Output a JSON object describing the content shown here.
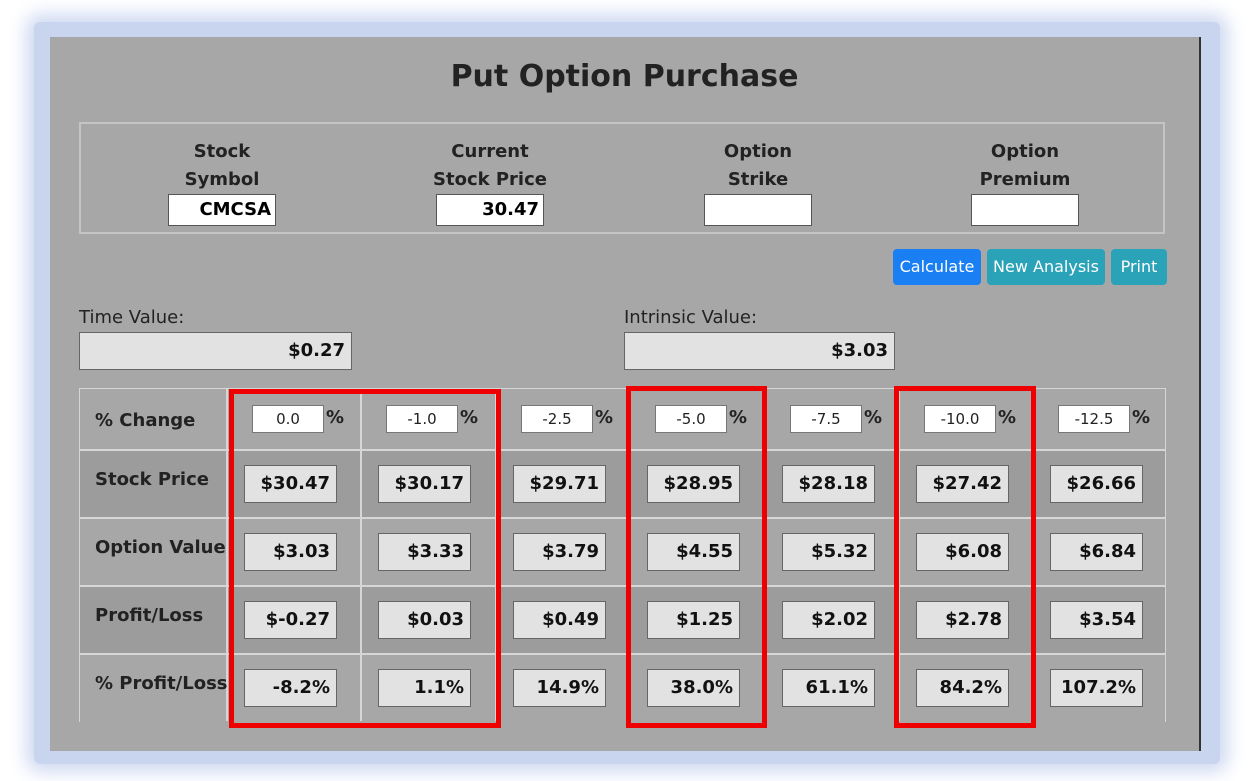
{
  "title": "Put Option Purchase",
  "inputs": [
    {
      "label_line1": "Stock",
      "label_line2": "Symbol",
      "value": "CMCSA"
    },
    {
      "label_line1": "Current",
      "label_line2": "Stock Price",
      "value": "30.47"
    },
    {
      "label_line1": "Option",
      "label_line2": "Strike",
      "value": ""
    },
    {
      "label_line1": "Option",
      "label_line2": "Premium",
      "value": ""
    }
  ],
  "buttons": {
    "calculate": "Calculate",
    "new_analysis": "New Analysis",
    "print": "Print"
  },
  "time_value": {
    "label": "Time Value:",
    "value": "$0.27"
  },
  "intrinsic_value": {
    "label": "Intrinsic Value:",
    "value": "$3.03"
  },
  "table": {
    "pct_symbol": "%",
    "row_labels": [
      "% Change",
      "Stock Price",
      "Option Value",
      "Profit/Loss",
      "% Profit/Loss"
    ],
    "pct_change": [
      "0.0",
      "-1.0",
      "-2.5",
      "-5.0",
      "-7.5",
      "-10.0",
      "-12.5"
    ],
    "stock_price": [
      "$30.47",
      "$30.17",
      "$29.71",
      "$28.95",
      "$28.18",
      "$27.42",
      "$26.66"
    ],
    "option_value": [
      "$3.03",
      "$3.33",
      "$3.79",
      "$4.55",
      "$5.32",
      "$6.08",
      "$6.84"
    ],
    "profit_loss": [
      "$-0.27",
      "$0.03",
      "$0.49",
      "$1.25",
      "$2.02",
      "$2.78",
      "$3.54"
    ],
    "pct_profit_loss": [
      "-8.2%",
      "1.1%",
      "14.9%",
      "38.0%",
      "61.1%",
      "84.2%",
      "107.2%"
    ]
  },
  "colors": {
    "panel_bg": "#a7a7a7",
    "highlight_border": "#ee0000",
    "calculate_button": "#1a7ff3",
    "info_button": "#2aa2b8"
  }
}
